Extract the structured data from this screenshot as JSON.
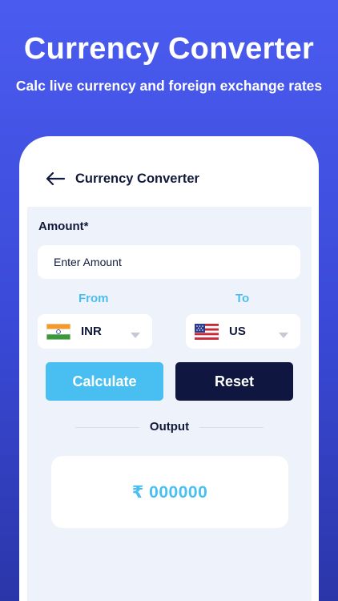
{
  "promo": {
    "headline": "Currency Converter",
    "subline": "Calc live currency and foreign exchange rates"
  },
  "topbar": {
    "title": "Currency Converter",
    "back_icon": "arrow-left-icon"
  },
  "form": {
    "amount_label": "Amount*",
    "amount_placeholder": "Enter Amount",
    "from_label": "From",
    "to_label": "To",
    "from_currency": {
      "code": "INR",
      "flag_icon": "india-flag-icon"
    },
    "to_currency": {
      "code": "US",
      "flag_icon": "usa-flag-icon"
    },
    "calculate_label": "Calculate",
    "reset_label": "Reset",
    "output_label": "Output",
    "output_value": "₹ 000000"
  },
  "colors": {
    "background": "#4a5cf0",
    "accent": "#48bff0",
    "dark": "#0f1741",
    "panel": "#eef2fb"
  }
}
